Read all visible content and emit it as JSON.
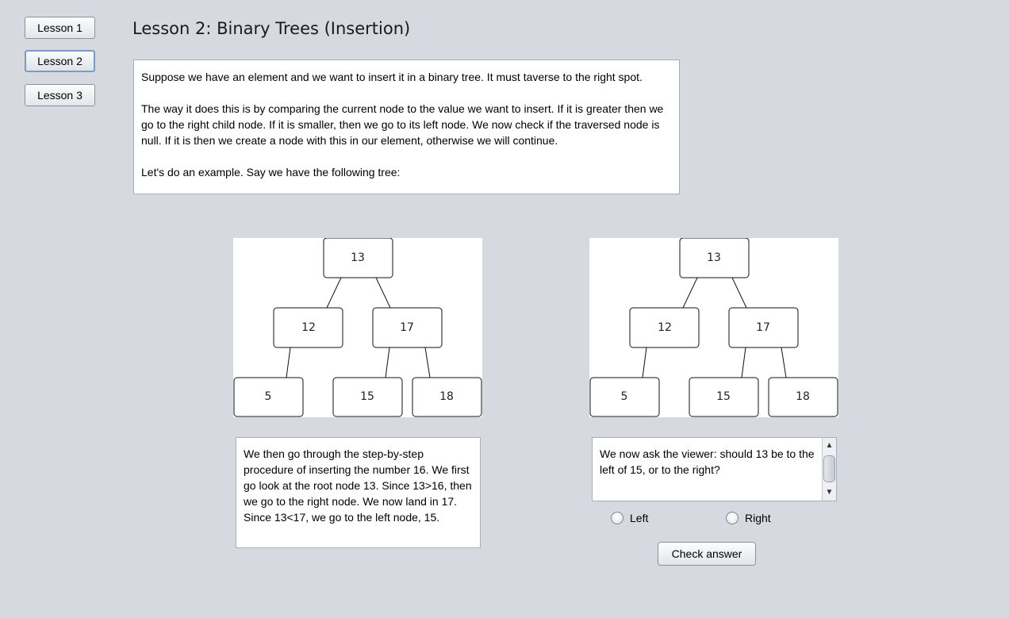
{
  "sidebar": {
    "buttons": [
      {
        "label": "Lesson 1"
      },
      {
        "label": "Lesson 2"
      },
      {
        "label": "Lesson 3"
      }
    ]
  },
  "title": "Lesson 2: Binary Trees (Insertion)",
  "intro": {
    "paragraphs": [
      "Suppose we have an element and we want to insert it in a binary tree. It must taverse to the right spot.",
      "The way it does this is by comparing the current node to the value we want to insert. If it is greater then we go to the right child node. If it is smaller, then we go to its left node. We now check if the traversed node is null. If it is then we create a node with this in our element, otherwise we will continue.",
      "Let's do an example. Say we have the following tree:"
    ]
  },
  "trees": [
    {
      "nodes": [
        "13",
        "12",
        "17",
        "5",
        "15",
        "18"
      ]
    },
    {
      "nodes": [
        "13",
        "12",
        "17",
        "5",
        "15",
        "18"
      ]
    }
  ],
  "description": "We then go through the step-by-step procedure of inserting the number 16. We first go look at the root node 13. Since 13>16, then we go to the right node. We now land in 17. Since 13<17, we go to the left node, 15.",
  "question": "We now ask the viewer: should 13 be to the left of 15, or to the right?",
  "options": {
    "left": "Left",
    "right": "Right"
  },
  "check_button": "Check answer"
}
